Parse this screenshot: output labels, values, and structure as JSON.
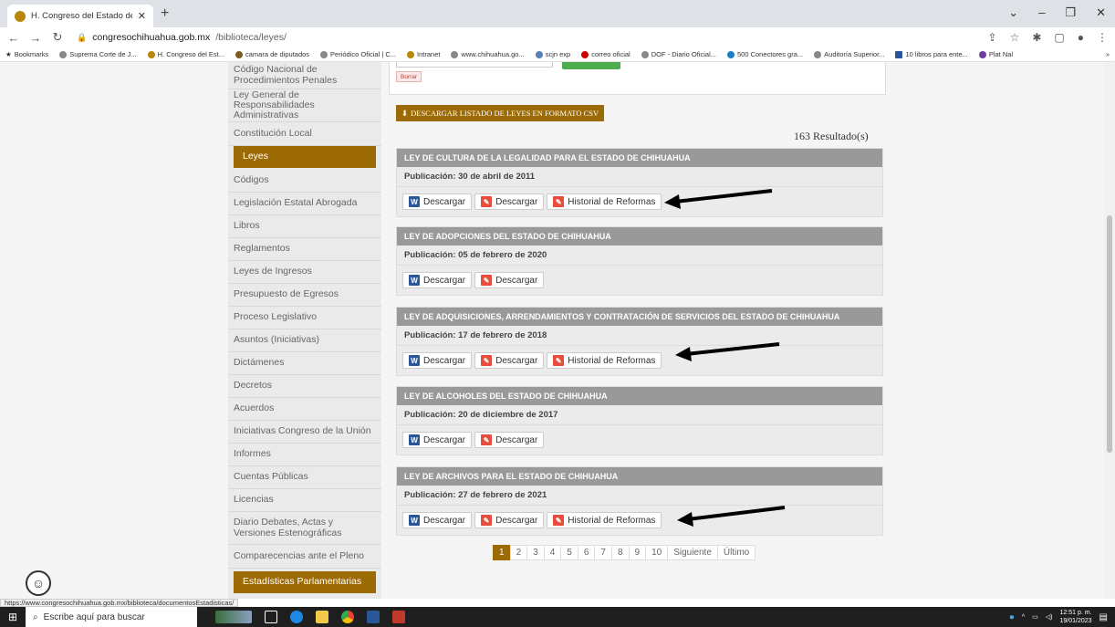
{
  "browser": {
    "tab_title": "H. Congreso del Estado de Chih",
    "tab_close": "✕",
    "new_tab": "+",
    "url_domain": "congresochihuahua.gob.mx",
    "url_path": "/biblioteca/leyes/",
    "bookmarks": [
      "Bookmarks",
      "Suprema Corte de J...",
      "H. Congreso del Est...",
      "camara de diputados",
      "Periódico Oficial | C...",
      "Intranet",
      "www.chihuahua.go...",
      "scjn exp",
      "correo oficial",
      "DOF - Diario Oficial...",
      "500 Conectores gra...",
      "Auditoría Superior...",
      "10 libros para ente...",
      "Plat Nal"
    ],
    "bookmarks_more": "»"
  },
  "filters": {
    "borrar_label": "Borrar"
  },
  "sidebar": {
    "items": [
      "Código Nacional de Procedimientos Penales",
      "Ley General de Responsabilidades Administrativas",
      "Constitución Local",
      "Leyes",
      "Códigos",
      "Legislación Estatal Abrogada",
      "Libros",
      "Reglamentos",
      "Leyes de Ingresos",
      "Presupuesto de Egresos",
      "Proceso Legislativo",
      "Asuntos (Iniciativas)",
      "Dictámenes",
      "Decretos",
      "Acuerdos",
      "Iniciativas Congreso de la Unión",
      "Informes",
      "Cuentas Públicas",
      "Licencias",
      "Diario Debates, Actas y Versiones Estenográficas",
      "Comparecencias ante el Pleno",
      "Estadísticas Parlamentarias"
    ],
    "active": "Leyes"
  },
  "main": {
    "csv_button": "DESCARGAR LISTADO DE LEYES EN FORMATO CSV",
    "results": "163 Resultado(s)",
    "laws": [
      {
        "title": "LEY DE CULTURA DE LA LEGALIDAD PARA EL ESTADO DE CHIHUAHUA",
        "publication": "Publicación: 30 de abril de 2011",
        "word": "Descargar",
        "pdf": "Descargar",
        "history": "Historial de Reformas"
      },
      {
        "title": "LEY DE ADOPCIONES DEL ESTADO DE CHIHUAHUA",
        "publication": "Publicación: 05 de febrero de 2020",
        "word": "Descargar",
        "pdf": "Descargar",
        "history": ""
      },
      {
        "title": "LEY DE ADQUISICIONES, ARRENDAMIENTOS Y CONTRATACIÓN DE SERVICIOS DEL ESTADO DE CHIHUAHUA",
        "publication": "Publicación: 17 de febrero de 2018",
        "word": "Descargar",
        "pdf": "Descargar",
        "history": "Historial de Reformas"
      },
      {
        "title": "LEY DE ALCOHOLES DEL ESTADO DE CHIHUAHUA",
        "publication": "Publicación: 20 de diciembre de 2017",
        "word": "Descargar",
        "pdf": "Descargar",
        "history": ""
      },
      {
        "title": "LEY DE ARCHIVOS PARA EL ESTADO DE CHIHUAHUA",
        "publication": "Publicación: 27 de febrero de 2021",
        "word": "Descargar",
        "pdf": "Descargar",
        "history": "Historial de Reformas"
      }
    ],
    "pagination": [
      "1",
      "2",
      "3",
      "4",
      "5",
      "6",
      "7",
      "8",
      "9",
      "10",
      "Siguiente",
      "Último"
    ],
    "current_page": "1"
  },
  "status_url": "https://www.congresochihuahua.gob.mx/biblioteca/documentosEstadisticas/",
  "taskbar": {
    "search_placeholder": "Escribe aquí para buscar",
    "time": "12:51 p. m.",
    "date": "19/01/2023"
  },
  "colors": {
    "accent": "#9c6b05",
    "law_header": "#999999",
    "active_page": "#9c6b05"
  }
}
